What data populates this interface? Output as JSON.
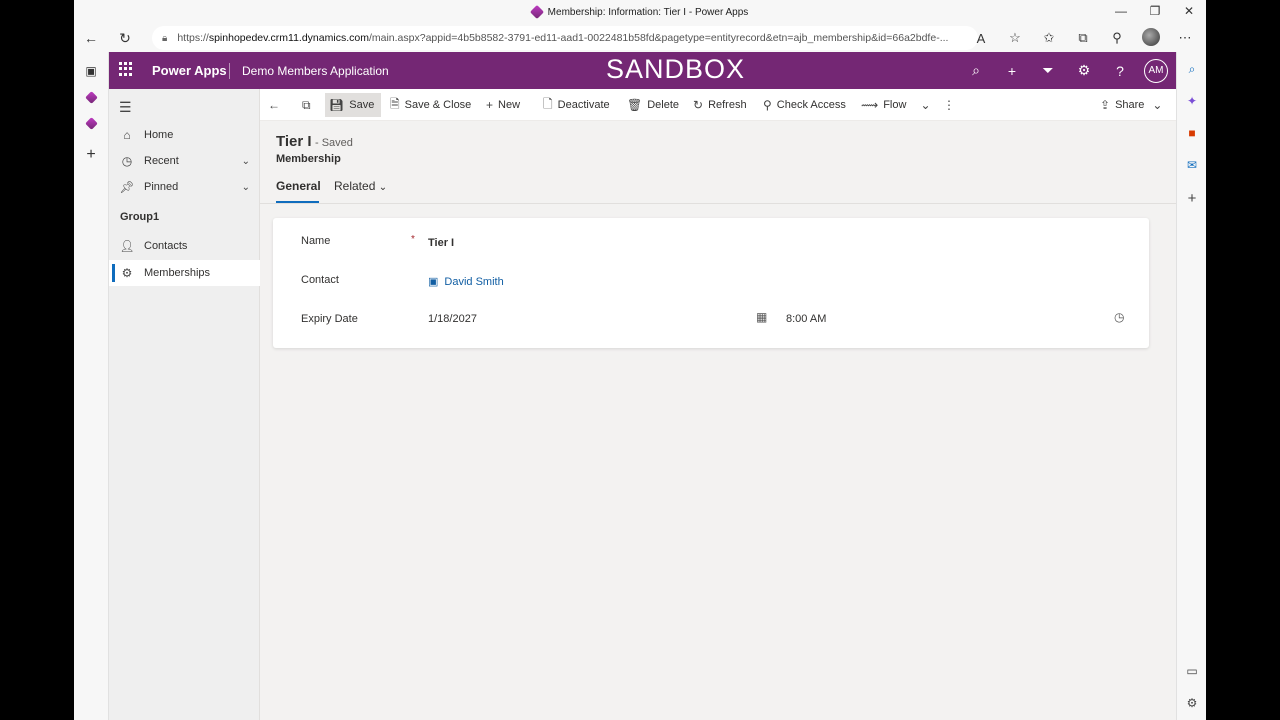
{
  "browser": {
    "window_title": "Membership: Information: Tier I - Power Apps",
    "url_prefix": "https://",
    "url_host": "spinhopedev.crm11.dynamics.com",
    "url_path": "/main.aspx?appid=4b5b8582-3791-ed11-aad1-0022481b58fd&pagetype=entityrecord&etn=ajb_membership&id=66a2bdfe-..."
  },
  "app": {
    "brand": "Power Apps",
    "name": "Demo Members Application",
    "environment_banner": "SANDBOX",
    "user_initials": "AM",
    "accent_color": "#742774"
  },
  "nav": {
    "items": [
      {
        "label": "Home"
      },
      {
        "label": "Recent"
      },
      {
        "label": "Pinned"
      }
    ],
    "group_label": "Group1",
    "group_items": [
      {
        "label": "Contacts"
      },
      {
        "label": "Memberships"
      }
    ]
  },
  "commands": {
    "save": "Save",
    "save_close": "Save & Close",
    "new": "New",
    "deactivate": "Deactivate",
    "delete": "Delete",
    "refresh": "Refresh",
    "check_access": "Check Access",
    "flow": "Flow",
    "share": "Share"
  },
  "record": {
    "title": "Tier I",
    "status": "- Saved",
    "entity": "Membership",
    "tabs": [
      {
        "label": "General"
      },
      {
        "label": "Related"
      }
    ]
  },
  "form": {
    "name_label": "Name",
    "name_value": "Tier I",
    "contact_label": "Contact",
    "contact_value": "David Smith",
    "expiry_label": "Expiry Date",
    "expiry_date": "1/18/2027",
    "expiry_time": "8:00 AM"
  }
}
